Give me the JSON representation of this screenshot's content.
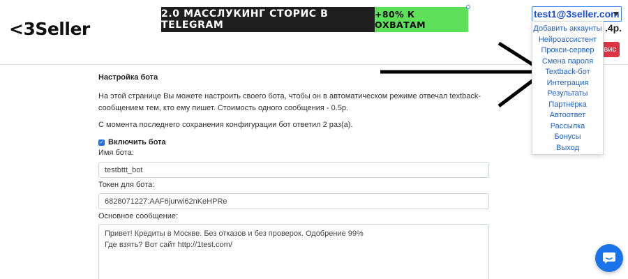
{
  "header": {
    "logo": "<3Seller",
    "banner": {
      "main_text": "2.0 МАССЛУКИНГ СТОРИС В TELEGRAM",
      "accent_text": "+80% К ОХВАТАМ",
      "accent_color": "#5ee05a"
    },
    "user_select": {
      "value": "test1@3seller.com"
    },
    "balance_fragment": ".4р.",
    "red_button_fragment": "вис"
  },
  "dropdown": {
    "items": [
      "Добавить аккаунты",
      "Нейроассистент",
      "Прокси-сервер",
      "Смена пароля",
      "Textback-бот",
      "Интеграция",
      "Результаты",
      "Партнёрка",
      "Автоответ",
      "Рассылка",
      "Бонусы",
      "Выход"
    ]
  },
  "page": {
    "title": "Настройка бота",
    "description": "На этой странице Вы можете настроить своего бота, чтобы он в автоматическом режиме отвечал textback-сообщением тем, кто ему пишет. Стоимость одного сообщения - 0.5р.",
    "stats_text": "С момента последнего сохранения конфигурации бот ответил 2 раз(а).",
    "enable_label": "Включить бота",
    "enable_checked": true,
    "bot_name_label": "Имя бота:",
    "bot_name_value": "testbttt_bot",
    "token_label": "Токен для бота:",
    "token_value": "6828071227:AAF6jurwi62nKeHPRe",
    "message_label": "Основное сообщение:",
    "message_value": "Привет! Кредиты в Москве. Без отказов и без проверок. Одобрение 99%\nГде взять? Вот сайт http://1test.com/"
  },
  "colors": {
    "link_blue": "#1f5fcf",
    "primary": "#1a73e8",
    "danger": "#dc3545"
  },
  "icons": {
    "chat": "chat-bubble-icon",
    "annotation": "arrow-right-icon"
  }
}
